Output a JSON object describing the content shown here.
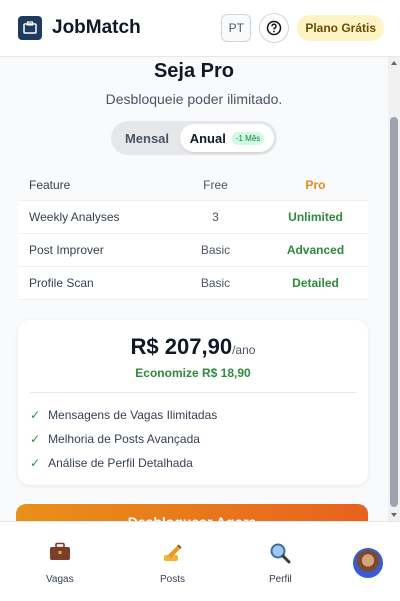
{
  "header": {
    "app_title": "JobMatch",
    "language": "PT",
    "plan_badge": "Plano Grátis"
  },
  "page": {
    "title": "Seja Pro",
    "subtitle": "Desbloqueie poder ilimitado."
  },
  "billing_toggle": {
    "monthly_label": "Mensal",
    "yearly_label": "Anual",
    "yearly_badge": "-1 Mês",
    "selected": "Anual"
  },
  "comparison": {
    "headers": [
      "Feature",
      "Free",
      "Pro"
    ],
    "rows": [
      [
        "Weekly Analyses",
        "3",
        "Unlimited"
      ],
      [
        "Post Improver",
        "Basic",
        "Advanced"
      ],
      [
        "Profile Scan",
        "Basic",
        "Detailed"
      ]
    ]
  },
  "pricing": {
    "amount": "R$ 207,90",
    "period": "/ano",
    "savings": "Economize R$ 18,90",
    "features": [
      "Mensagens de Vagas Ilimitadas",
      "Melhoria de Posts Avançada",
      "Análise de Perfil Detalhada"
    ],
    "cta": "Desbloquear Agora"
  },
  "nav": {
    "items": [
      {
        "label": "Vagas",
        "icon": "briefcase-icon"
      },
      {
        "label": "Posts",
        "icon": "writing-hand-icon"
      },
      {
        "label": "Perfil",
        "icon": "magnifier-icon"
      }
    ]
  },
  "colors": {
    "accent_orange": "#e08a1a",
    "green": "#2e8b3e",
    "badge_bg": "#fdf3c4"
  }
}
